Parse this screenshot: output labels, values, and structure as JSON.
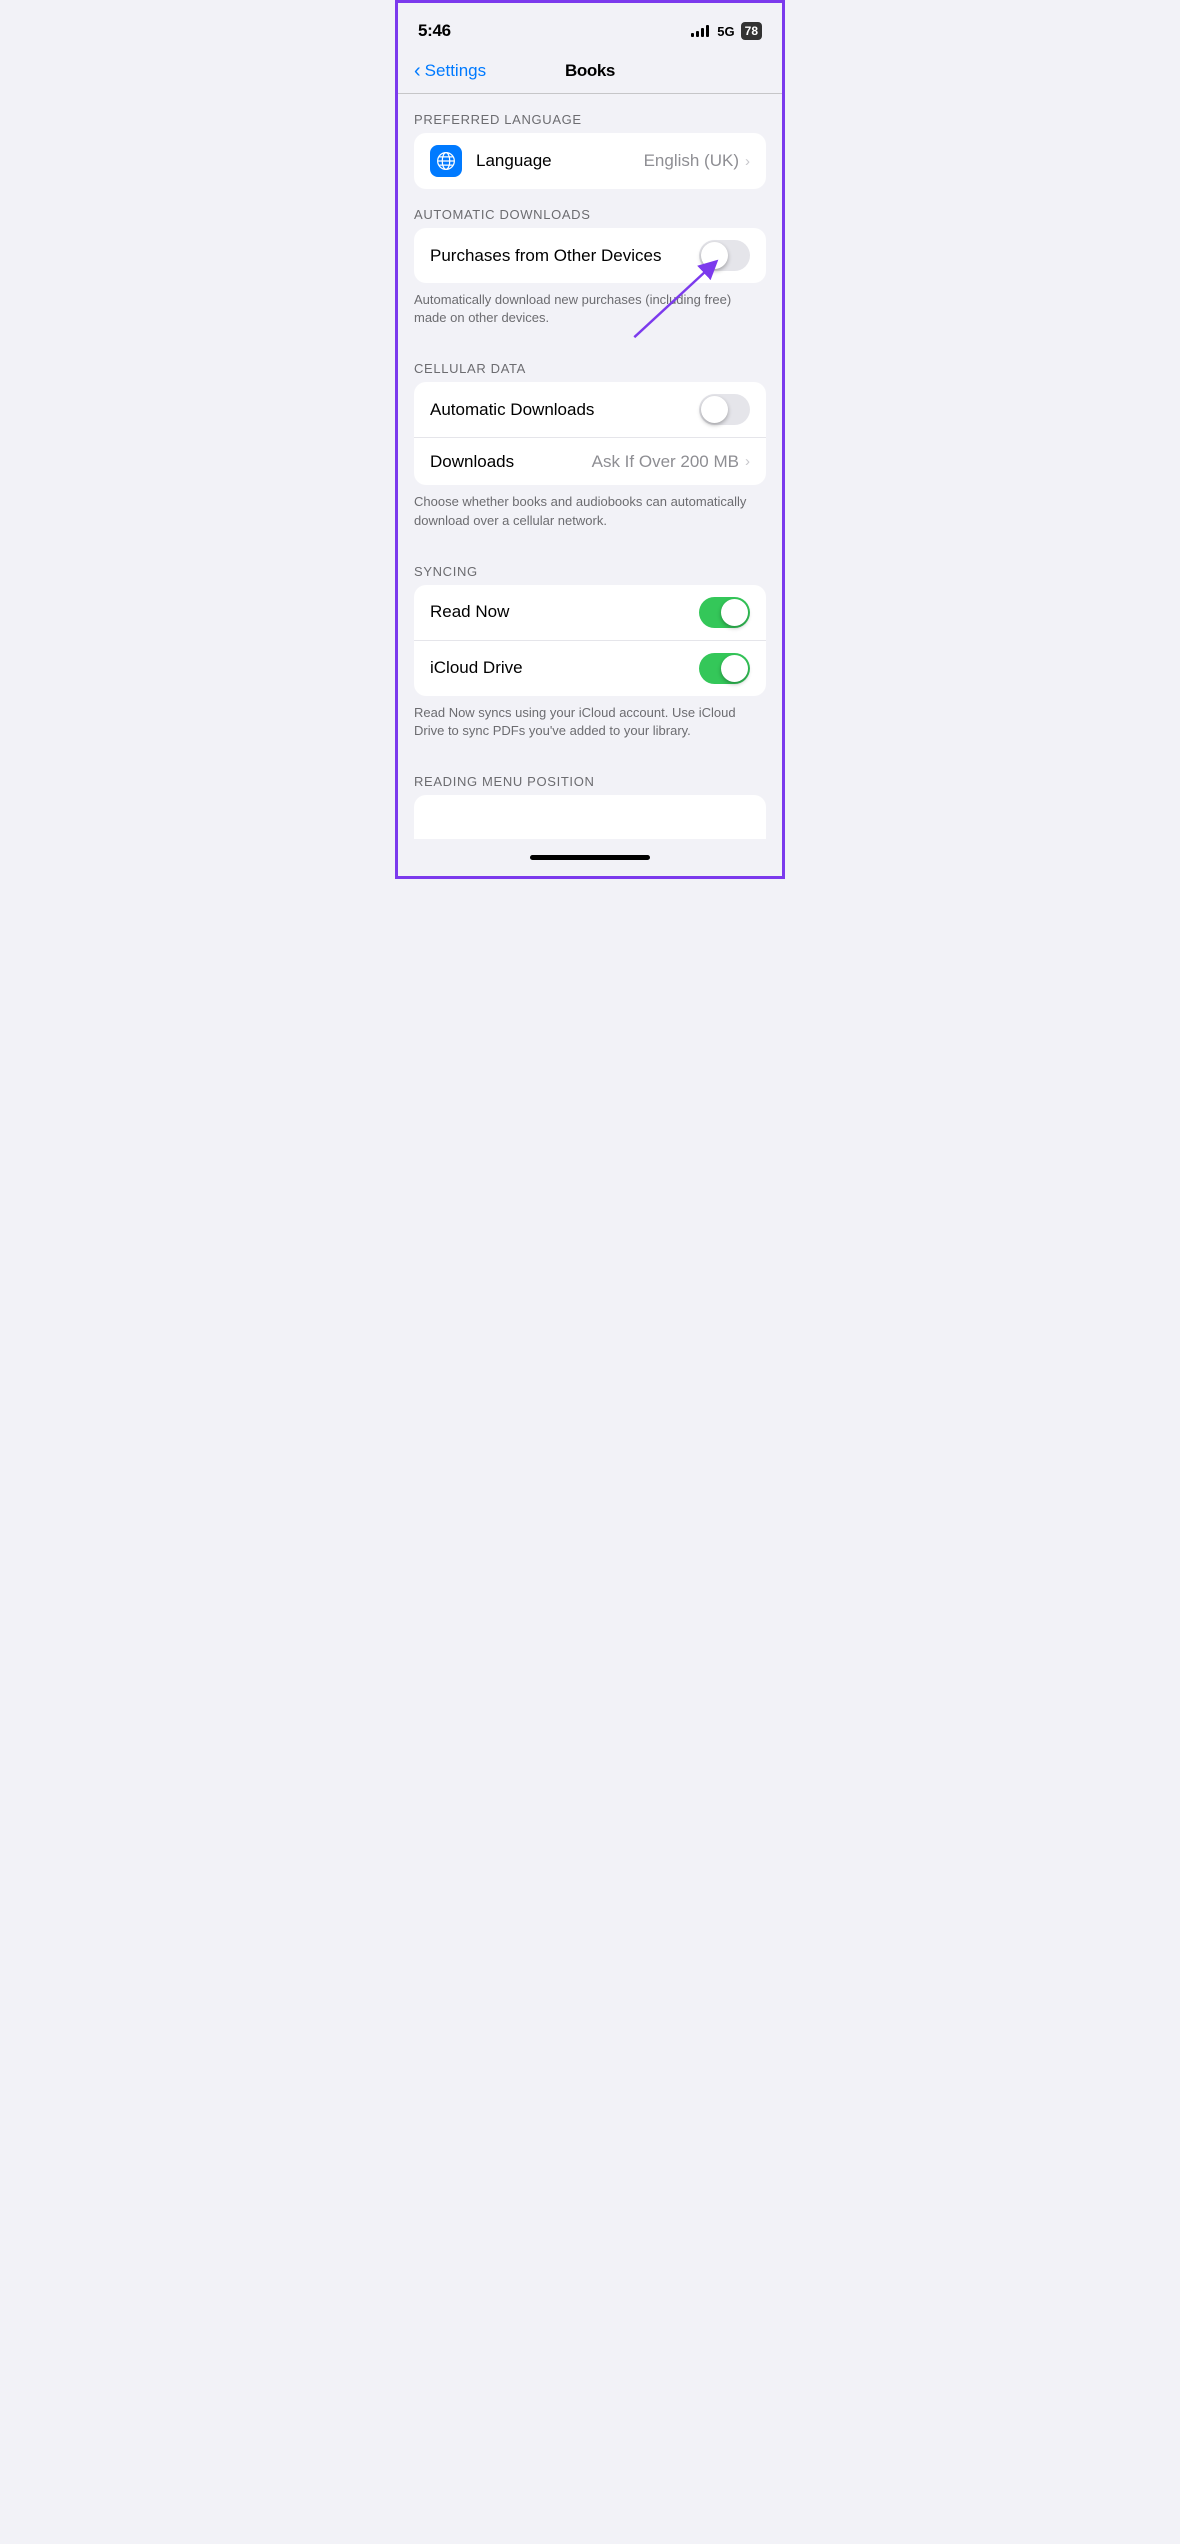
{
  "statusBar": {
    "time": "5:46",
    "network": "5G",
    "battery": "78",
    "signalBars": 4
  },
  "navBar": {
    "backLabel": "Settings",
    "title": "Books"
  },
  "sections": {
    "preferredLanguage": {
      "header": "PREFERRED LANGUAGE",
      "rows": [
        {
          "icon": "globe",
          "label": "Language",
          "value": "English (UK)",
          "hasChevron": true
        }
      ]
    },
    "automaticDownloads": {
      "header": "AUTOMATIC DOWNLOADS",
      "rows": [
        {
          "label": "Purchases from Other Devices",
          "toggle": "off"
        }
      ],
      "footer": "Automatically download new purchases (including free) made on other devices."
    },
    "cellularData": {
      "header": "CELLULAR DATA",
      "rows": [
        {
          "label": "Automatic Downloads",
          "toggle": "off"
        },
        {
          "label": "Downloads",
          "value": "Ask If Over 200 MB",
          "hasChevron": true
        }
      ],
      "footer": "Choose whether books and audiobooks can automatically download over a cellular network."
    },
    "syncing": {
      "header": "SYNCING",
      "rows": [
        {
          "label": "Read Now",
          "toggle": "on"
        },
        {
          "label": "iCloud Drive",
          "toggle": "on"
        }
      ],
      "footer": "Read Now syncs using your iCloud account. Use iCloud Drive to sync PDFs you've added to your library."
    },
    "readingMenuPosition": {
      "header": "READING MENU POSITION"
    }
  },
  "arrow": {
    "color": "#7c3aed"
  }
}
